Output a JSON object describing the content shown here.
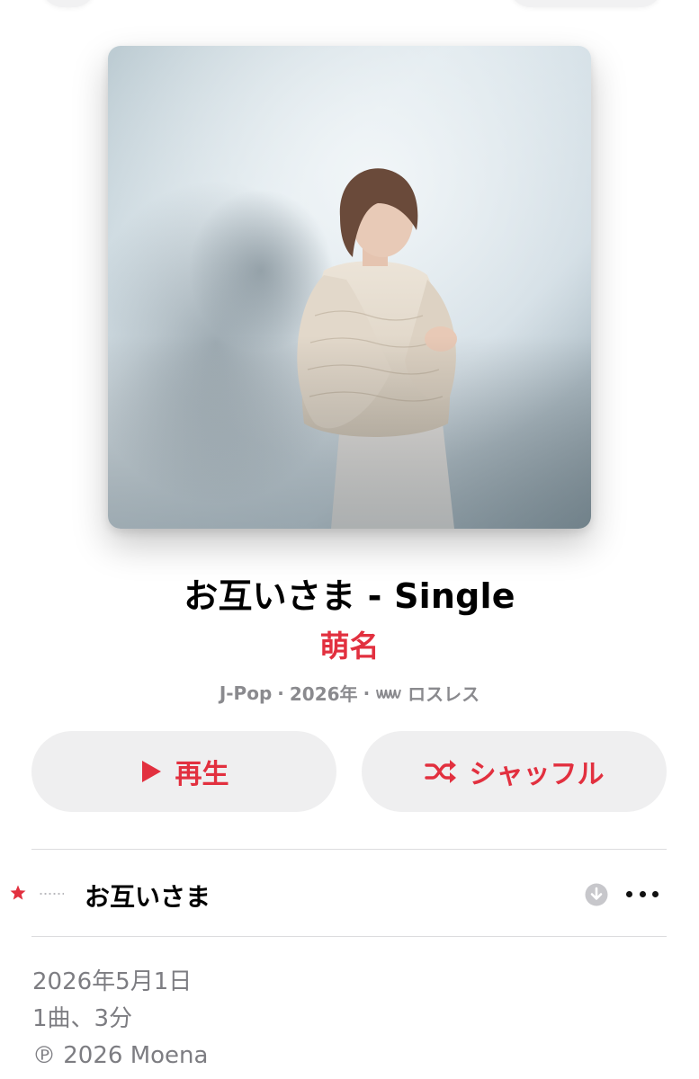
{
  "album": {
    "title": "お互いさま - Single",
    "artist": "萌名",
    "genre": "J-Pop",
    "year": "2026年",
    "quality": "ロスレス",
    "separator": "·"
  },
  "actions": {
    "play_label": "再生",
    "shuffle_label": "シャッフル"
  },
  "tracks": [
    {
      "title": "お互いさま",
      "favorite": true
    }
  ],
  "footer": {
    "release_date": "2026年5月1日",
    "summary": "1曲、3分",
    "copyright": "℗ 2026 Moena"
  },
  "colors": {
    "accent": "#e2303f",
    "secondary_text": "#8a8a8e",
    "button_bg": "#efeff0"
  }
}
